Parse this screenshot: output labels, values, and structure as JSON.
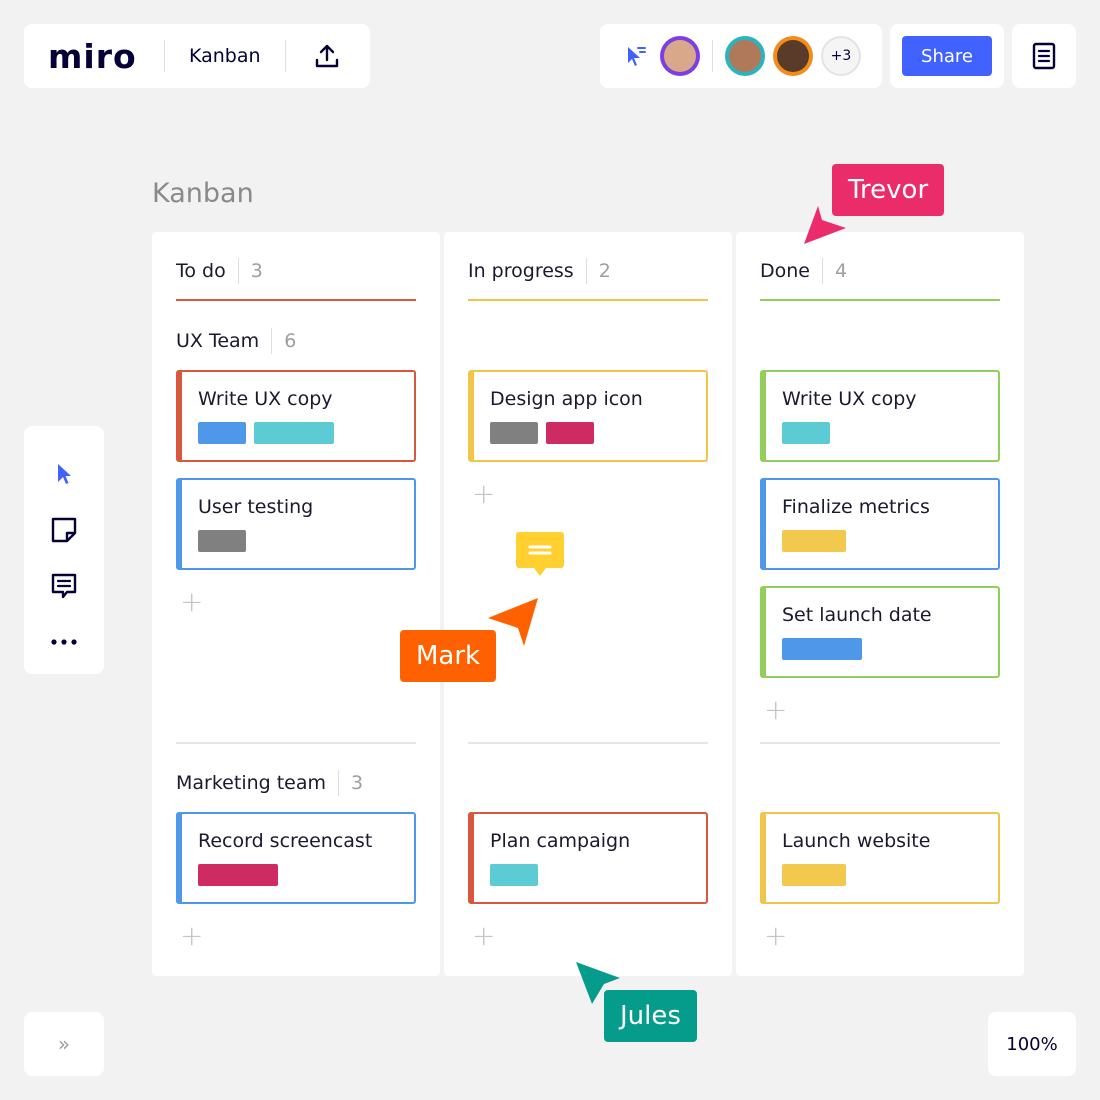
{
  "app": {
    "logo": "miro",
    "board_title": "Kanban"
  },
  "collaborators": {
    "more_count": "+3",
    "share_label": "Share"
  },
  "zoom": "100%",
  "kanban_title": "Kanban",
  "columns": [
    {
      "name": "To do",
      "count": "3",
      "accent": "#d9573f",
      "groups": [
        {
          "name": "UX Team",
          "count": "6",
          "cards": [
            {
              "title": "Write UX copy",
              "border": "#d9573f",
              "tags": [
                {
                  "color": "#4f97e8"
                },
                {
                  "color": "#5ccbd3"
                }
              ]
            },
            {
              "title": "User testing",
              "border": "#4f97e8",
              "tags": [
                {
                  "color": "#808080"
                }
              ]
            }
          ]
        },
        {
          "name": "Marketing team",
          "count": "3",
          "cards": [
            {
              "title": "Record screencast",
              "border": "#4f97e8",
              "tags": [
                {
                  "color": "#cf2b63"
                }
              ]
            }
          ]
        }
      ]
    },
    {
      "name": "In progress",
      "count": "2",
      "accent": "#f0c54a",
      "groups": [
        {
          "cards": [
            {
              "title": "Design app icon",
              "border": "#f0c54a",
              "tags": [
                {
                  "color": "#808080"
                },
                {
                  "color": "#cf2b63"
                }
              ]
            }
          ]
        },
        {
          "cards": [
            {
              "title": "Plan campaign",
              "border": "#d9573f",
              "tags": [
                {
                  "color": "#5ccbd3"
                }
              ]
            }
          ]
        }
      ]
    },
    {
      "name": "Done",
      "count": "4",
      "accent": "#8fcf5a",
      "groups": [
        {
          "cards": [
            {
              "title": "Write UX copy",
              "border": "#8fcf5a",
              "tags": [
                {
                  "color": "#5ccbd3"
                }
              ]
            },
            {
              "title": "Finalize metrics",
              "border": "#4f97e8",
              "tags": [
                {
                  "color": "#f2c94c"
                }
              ]
            },
            {
              "title": "Set launch date",
              "border": "#8fcf5a",
              "tags": [
                {
                  "color": "#4f97e8"
                }
              ]
            }
          ]
        },
        {
          "cards": [
            {
              "title": "Launch website",
              "border": "#f0c54a",
              "tags": [
                {
                  "color": "#f2c94c"
                }
              ]
            }
          ]
        }
      ]
    }
  ],
  "cursors": [
    {
      "name": "Trevor",
      "color": "#ea2c6b"
    },
    {
      "name": "Mark",
      "color": "#ff6100"
    },
    {
      "name": "Jules",
      "color": "#069c8c"
    }
  ],
  "colors": {
    "accent": "#4262ff",
    "canvas": "#f2f2f2"
  },
  "icons": [
    "upload-icon",
    "follow-cursor-icon",
    "select-icon",
    "sticky-note-icon",
    "comment-icon",
    "more-icon",
    "notes-icon",
    "expand-icon"
  ]
}
